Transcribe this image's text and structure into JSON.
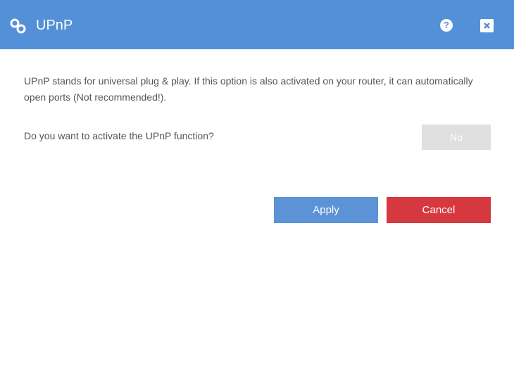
{
  "dialog": {
    "title": "UPnP",
    "title_icon": "link-icon",
    "help_label": "?",
    "close_icon": "close-icon",
    "header_color": "#5490d7"
  },
  "body": {
    "description": "UPnP stands for universal plug & play. If this option is also activated on your router, it can automatically open ports (Not recommended!).",
    "question": "Do you want to activate the UPnP function?",
    "toggle_value": "No"
  },
  "actions": {
    "apply_label": "Apply",
    "cancel_label": "Cancel",
    "apply_color": "#5b93d6",
    "cancel_color": "#d5393f"
  }
}
